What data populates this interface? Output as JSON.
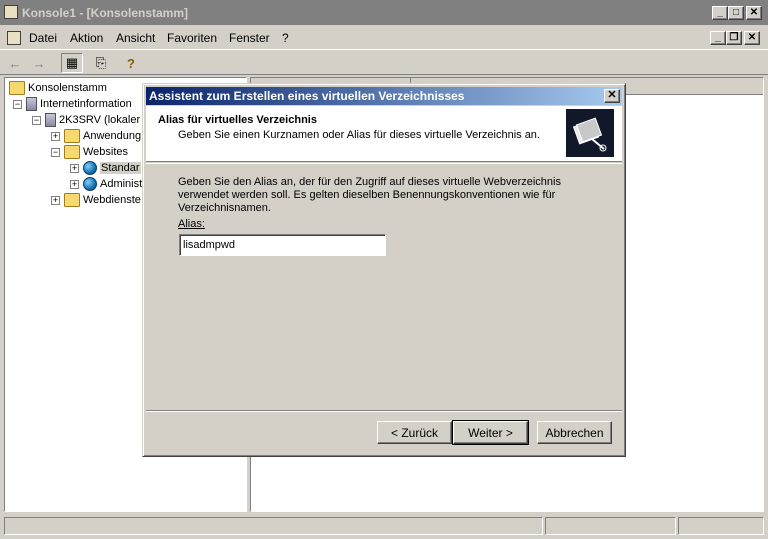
{
  "window": {
    "title": "Konsole1 - [Konsolenstamm]",
    "controls": {
      "minimize": "_",
      "maximize": "□",
      "close": "✕"
    },
    "child_controls": {
      "minimize": "_",
      "restore": "❐",
      "close": "✕"
    }
  },
  "menu": [
    "Datei",
    "Aktion",
    "Ansicht",
    "Favoriten",
    "Fenster",
    "?"
  ],
  "toolbar": {
    "back": "←",
    "forward": "→",
    "show_hide_tree": "▦",
    "export": "⎘",
    "help": "?"
  },
  "tree": {
    "root": "Konsolenstamm",
    "items": [
      {
        "label": "Internetinformation",
        "expander": "−",
        "icon": "iis-icon"
      },
      {
        "label": "2K3SRV (lokaler",
        "expander": "−",
        "icon": "server-icon"
      },
      {
        "label": "Anwendung",
        "expander": "+",
        "icon": "folder-icon"
      },
      {
        "label": "Websites",
        "expander": "−",
        "icon": "folder-icon"
      },
      {
        "label": "Standar",
        "expander": "+",
        "icon": "globe-icon"
      },
      {
        "label": "Administ",
        "expander": "+",
        "icon": "globe-icon"
      },
      {
        "label": "Webdienste",
        "expander": "+",
        "icon": "folder-icon"
      }
    ]
  },
  "dialog": {
    "title": "Assistent zum Erstellen eines virtuellen Verzeichnisses",
    "close": "✕",
    "header_title": "Alias für virtuelles Verzeichnis",
    "header_subtitle": "Geben Sie einen Kurznamen oder Alias für dieses virtuelle Verzeichnis an.",
    "description": "Geben Sie den Alias an, der für den Zugriff auf dieses virtuelle Webverzeichnis verwendet werden soll. Es gelten dieselben Benennungskonventionen wie für Verzeichnisnamen.",
    "alias_label": "Alias:",
    "alias_value": "lisadmpwd",
    "buttons": {
      "back": "< Zurück",
      "next": "Weiter >",
      "cancel": "Abbrechen"
    }
  },
  "colors": {
    "titlebar_active_start": "#0a246a",
    "titlebar_active_end": "#a6caf0",
    "titlebar_inactive": "#808080",
    "face": "#d4d0c8"
  }
}
